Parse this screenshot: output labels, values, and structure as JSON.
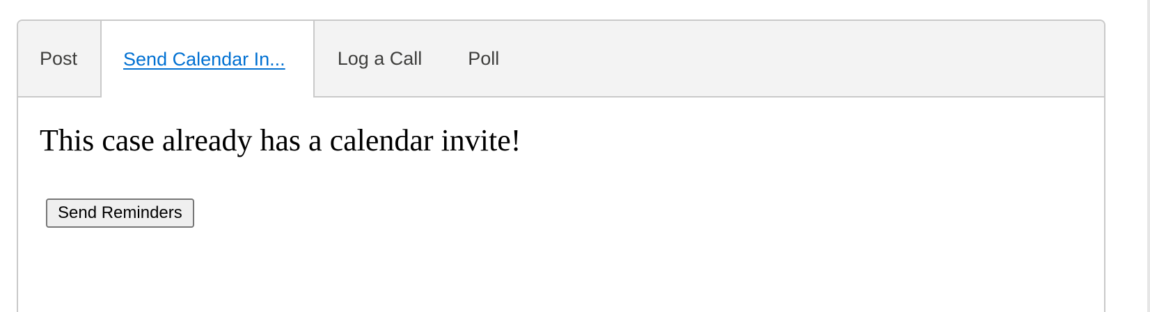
{
  "tabs": [
    {
      "label": "Post"
    },
    {
      "label": "Send Calendar In..."
    },
    {
      "label": "Log a Call"
    },
    {
      "label": "Poll"
    }
  ],
  "active_tab_index": 1,
  "main": {
    "heading": "This case already has a calendar invite!",
    "send_reminders_label": "Send Reminders"
  },
  "colors": {
    "active_tab_link": "#0070d2",
    "tabbar_background": "#f3f3f3",
    "border": "#c9c9c9"
  }
}
